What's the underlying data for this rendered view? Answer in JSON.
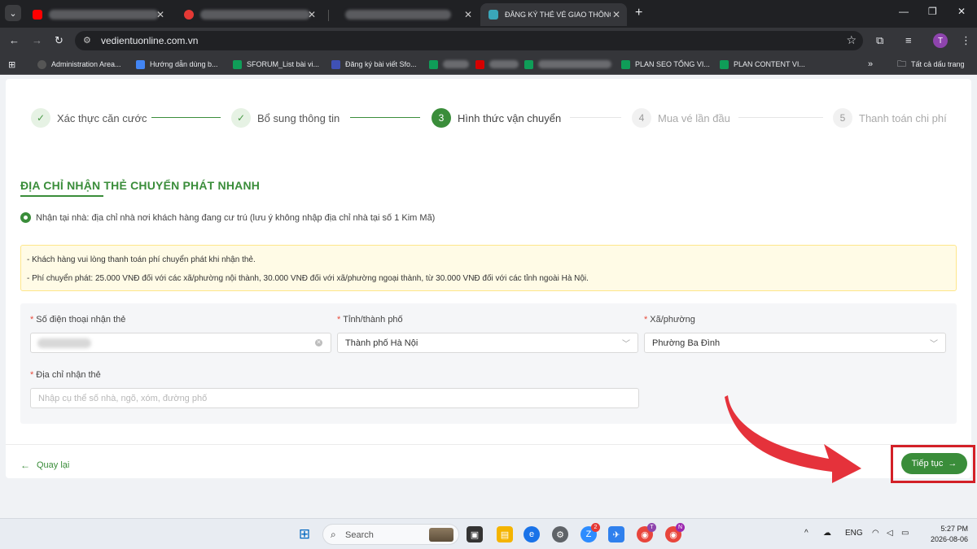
{
  "browser": {
    "tabs": [
      {
        "label": "",
        "favicon_color": "#ff0000"
      },
      {
        "label": "",
        "favicon_color": "#e53935"
      },
      {
        "label": "",
        "favicon_color": "#202124"
      },
      {
        "label": "ĐĂNG KÝ THẺ VÉ GIAO THÔNG",
        "favicon_color": "#3aa6b9"
      }
    ],
    "url": "vedientuonline.com.vn",
    "profile_initial": "T",
    "bookmarks": [
      {
        "label": "Administration Area...",
        "color": "#555555"
      },
      {
        "label": "Hướng dẫn dùng b...",
        "color": "#4285f4"
      },
      {
        "label": "SFORUM_List bài vi...",
        "color": "#0f9d58"
      },
      {
        "label": "Đăng ký bài viết Sfo...",
        "color": "#3f51b5"
      },
      {
        "label": "",
        "color": "#0f9d58"
      },
      {
        "label": "",
        "color": "#d50000"
      },
      {
        "label": "",
        "color": "#0f9d58"
      },
      {
        "label": "PLAN SEO TỔNG VI...",
        "color": "#0f9d58"
      },
      {
        "label": "PLAN CONTENT VI...",
        "color": "#0f9d58"
      }
    ],
    "all_bookmarks": "Tất cả dấu trang"
  },
  "steps": [
    {
      "index": "✓",
      "label": "Xác thực căn cước",
      "state": "done"
    },
    {
      "index": "✓",
      "label": "Bổ sung thông tin",
      "state": "done"
    },
    {
      "index": "3",
      "label": "Hình thức vận chuyển",
      "state": "active"
    },
    {
      "index": "4",
      "label": "Mua vé lần đầu",
      "state": "pending"
    },
    {
      "index": "5",
      "label": "Thanh toán chi phí",
      "state": "pending"
    }
  ],
  "section": {
    "title": "ĐỊA CHỈ NHẬN THẺ CHUYỂN PHÁT NHANH",
    "radio_label": "Nhận tại nhà: địa chỉ nhà nơi khách hàng đang cư trú (lưu ý không nhập địa chỉ nhà tại số 1 Kim Mã)"
  },
  "notice": {
    "line1": "- Khách hàng vui lòng thanh toán phí chuyển phát khi nhận thẻ.",
    "line2": "- Phí chuyển phát: 25.000 VNĐ đối với các xã/phường nội thành, 30.000 VNĐ đối với xã/phường ngoại thành, từ 30.000 VNĐ đối với các tỉnh ngoài Hà Nội."
  },
  "form": {
    "phone_label": "Số điện thoại nhận thẻ",
    "city_label": "Tỉnh/thành phố",
    "city_value": "Thành phố Hà Nội",
    "ward_label": "Xã/phường",
    "ward_value": "Phường Ba Đình",
    "address_label": "Địa chỉ nhận thẻ",
    "address_placeholder": "Nhập cụ thể số nhà, ngõ, xóm, đường phố"
  },
  "actions": {
    "back_label": "Quay lại",
    "next_label": "Tiếp tục"
  },
  "taskbar": {
    "search_label": "Search",
    "lang": "ENG",
    "time": "5:27 PM",
    "date": "2026-08-06"
  },
  "colors": {
    "brand_green": "#3a8d3a",
    "highlight_red": "#d32027",
    "notice_bg": "#fffbe6"
  }
}
